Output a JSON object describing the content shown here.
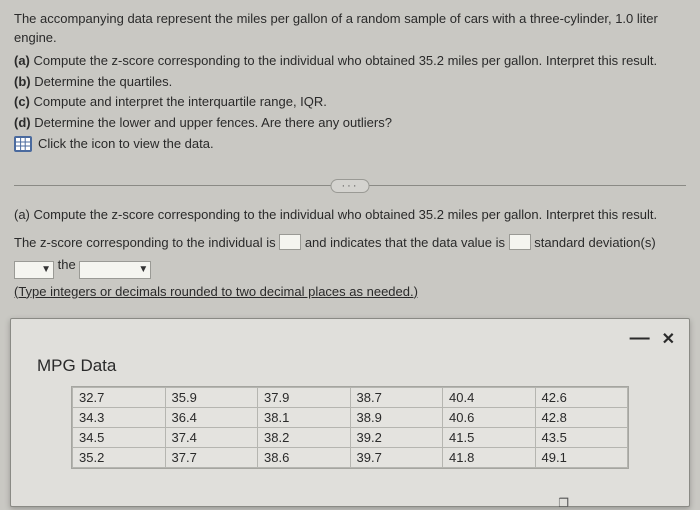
{
  "intro": "The accompanying data represent the miles per gallon of a random sample of cars with a three-cylinder, 1.0 liter engine.",
  "parts": {
    "a": "Compute the z-score corresponding to the individual who obtained 35.2 miles per gallon. Interpret this result.",
    "b": "Determine the quartiles.",
    "c": "Compute and interpret the interquartile range, IQR.",
    "d": "Determine the lower and upper fences. Are there any outliers?"
  },
  "click_text": "Click the icon to view the data.",
  "divider_label": "···",
  "question": {
    "heading": "(a) Compute the z-score corresponding to the individual who obtained 35.2 miles per gallon. Interpret this result.",
    "sentence_pre": "The z-score corresponding to the individual is ",
    "sentence_mid": " and indicates that the data value is ",
    "sentence_post": " standard deviation(s)",
    "the_word": " the ",
    "note": "(Type integers or decimals rounded to two decimal places as needed.)"
  },
  "modal": {
    "title": "MPG Data",
    "minimize": "—",
    "close": "✕",
    "rows": [
      [
        "32.7",
        "35.9",
        "37.9",
        "38.7",
        "40.4",
        "42.6"
      ],
      [
        "34.3",
        "36.4",
        "38.1",
        "38.9",
        "40.6",
        "42.8"
      ],
      [
        "34.5",
        "37.4",
        "38.2",
        "39.2",
        "41.5",
        "43.5"
      ],
      [
        "35.2",
        "37.7",
        "38.6",
        "39.7",
        "41.8",
        "49.1"
      ]
    ]
  },
  "copy_glyph": "❐"
}
